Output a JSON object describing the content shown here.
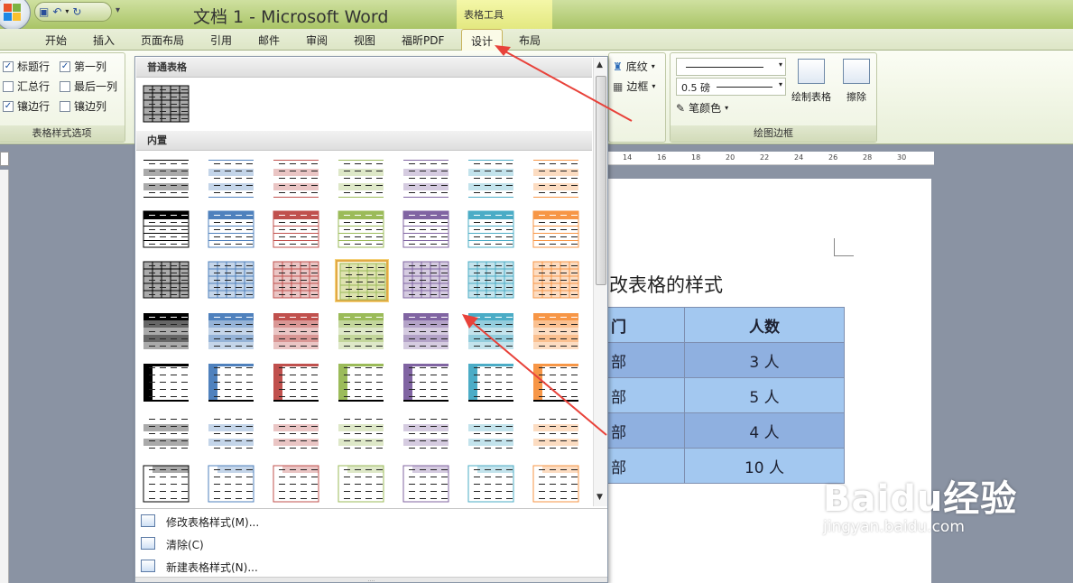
{
  "window": {
    "title": "文档 1 - Microsoft Word",
    "contextual_tab_group": "表格工具"
  },
  "tabs": [
    {
      "label": "开始"
    },
    {
      "label": "插入"
    },
    {
      "label": "页面布局"
    },
    {
      "label": "引用"
    },
    {
      "label": "邮件"
    },
    {
      "label": "审阅"
    },
    {
      "label": "视图"
    },
    {
      "label": "福昕PDF"
    },
    {
      "label": "设计",
      "active": true
    },
    {
      "label": "布局"
    }
  ],
  "table_style_options": {
    "group_label": "表格样式选项",
    "options": [
      {
        "label": "标题行",
        "checked": true
      },
      {
        "label": "第一列",
        "checked": true
      },
      {
        "label": "汇总行",
        "checked": false
      },
      {
        "label": "最后一列",
        "checked": false
      },
      {
        "label": "镶边行",
        "checked": true
      },
      {
        "label": "镶边列",
        "checked": false
      }
    ]
  },
  "shading": {
    "shading_label": "底纹",
    "borders_label": "边框"
  },
  "draw_borders": {
    "group_label": "绘图边框",
    "line_weight": "0.5 磅",
    "pen_color_label": "笔颜色",
    "draw_table_label": "绘制表格",
    "eraser_label": "擦除"
  },
  "ruler": {
    "ticks": [
      "14",
      "16",
      "18",
      "20",
      "22",
      "24",
      "26",
      "28",
      "30"
    ]
  },
  "document": {
    "heading": "改表格的样式",
    "table": {
      "header": [
        "门",
        "人数"
      ],
      "rows": [
        [
          "部",
          "3 人"
        ],
        [
          "部",
          "5 人"
        ],
        [
          "部",
          "4 人"
        ],
        [
          "部",
          "10 人"
        ]
      ]
    }
  },
  "gallery": {
    "section_plain": "普通表格",
    "section_builtin": "内置",
    "theme_colors": [
      "#000000",
      "#4f81bd",
      "#c0504d",
      "#9bbb59",
      "#8064a2",
      "#4bacc6",
      "#f79646"
    ],
    "selected_row": 2,
    "selected_col": 3,
    "menu": [
      {
        "label": "修改表格样式(M)...",
        "icon": "modify-table-style-icon"
      },
      {
        "label": "清除(C)",
        "icon": "clear-icon"
      },
      {
        "label": "新建表格样式(N)...",
        "icon": "new-table-style-icon"
      }
    ]
  },
  "watermark": {
    "brand": "Baidu经验",
    "url": "jingyan.baidu.com"
  },
  "annotation_color": "#e8423a"
}
